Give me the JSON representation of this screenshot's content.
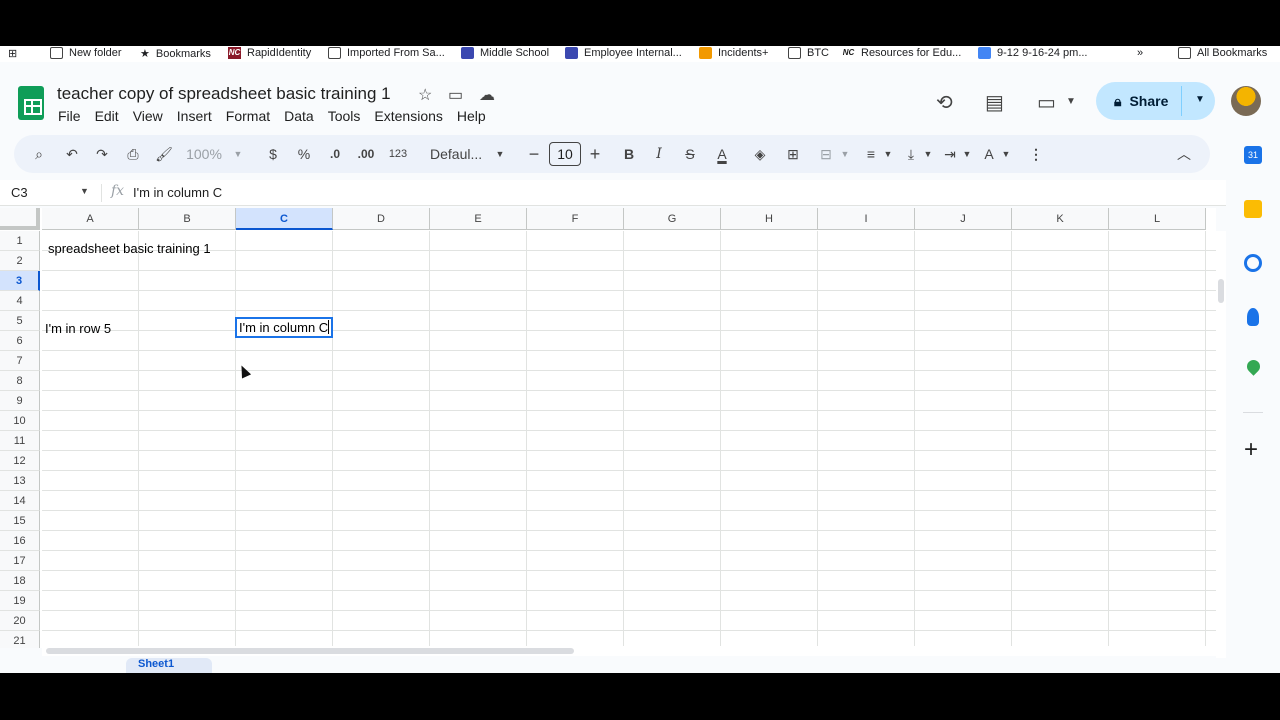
{
  "bookmarks": {
    "items": [
      "New folder",
      "Bookmarks",
      "RapidIdentity",
      "Imported From Sa...",
      "Middle School",
      "Employee Internal...",
      "Incidents+",
      "BTC",
      "Resources for Edu...",
      "9-12 9-16-24 pm...",
      "All Bookmarks"
    ],
    "overflow": "»"
  },
  "doc": {
    "title": "teacher copy of spreadsheet basic training 1",
    "menu": [
      "File",
      "Edit",
      "View",
      "Insert",
      "Format",
      "Data",
      "Tools",
      "Extensions",
      "Help"
    ],
    "share_label": "Share"
  },
  "toolbar": {
    "zoom": "100%",
    "currency": "$",
    "percent": "%",
    "dec_decrease": ".0",
    "dec_increase": ".00",
    "number_format": "123",
    "font": "Defaul...",
    "font_size": "10"
  },
  "formula_bar": {
    "name_box": "C3",
    "fx": "fx",
    "value": "I'm in column C"
  },
  "grid": {
    "columns": [
      "A",
      "B",
      "C",
      "D",
      "E",
      "F",
      "G",
      "H",
      "I",
      "J",
      "K",
      "L"
    ],
    "rows": [
      "1",
      "2",
      "3",
      "4",
      "5",
      "6",
      "7",
      "8",
      "9",
      "10",
      "11",
      "12",
      "13",
      "14",
      "15",
      "16",
      "17",
      "18",
      "19",
      "20",
      "21"
    ],
    "selected_column": "C",
    "selected_row": "3",
    "cells": {
      "A1": "spreadsheet basic training 1",
      "C3": "I'm in column C",
      "A5": "I'm in row 5"
    }
  },
  "sheets": {
    "active": "Sheet1"
  },
  "side_panel": {
    "calendar_day": "31",
    "add": "+"
  },
  "colors": {
    "accent": "#0b57d0",
    "selection": "#1a73e8",
    "share_bg": "#c2e7ff",
    "sheets_green": "#0f9d58"
  }
}
